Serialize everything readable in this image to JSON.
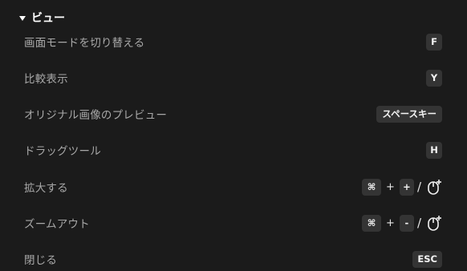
{
  "section": {
    "title": "ビュー"
  },
  "shortcuts": [
    {
      "label": "画面モードを切り替える",
      "key": "F"
    },
    {
      "label": "比較表示",
      "key": "Y"
    },
    {
      "label": "オリジナル画像のプレビュー",
      "key": "スペースキー"
    },
    {
      "label": "ドラッグツール",
      "key": "H"
    },
    {
      "label": "拡大する",
      "mod_key": "⌘",
      "plus": "+",
      "key": "+",
      "or": "/",
      "mouse_icon": "mouse-scroll-icon"
    },
    {
      "label": "ズームアウト",
      "mod_key": "⌘",
      "plus": "+",
      "key": "-",
      "or": "/",
      "mouse_icon": "mouse-scroll-icon"
    },
    {
      "label": "閉じる",
      "key": "ESC"
    }
  ],
  "colors": {
    "background": "#1b1b1b",
    "key_background": "#343434",
    "label_text": "#a8a8a8",
    "header_text": "#ffffff"
  }
}
